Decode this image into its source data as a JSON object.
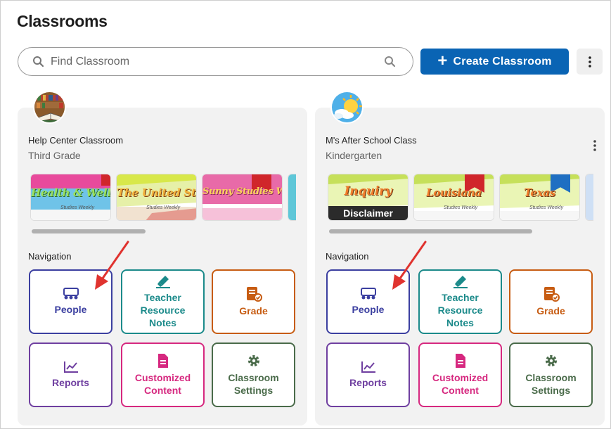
{
  "page": {
    "title": "Classrooms"
  },
  "search": {
    "placeholder": "Find Classroom"
  },
  "toolbar": {
    "create_label": "Create Classroom"
  },
  "classrooms": [
    {
      "name": "Help Center Classroom",
      "grade": "Third Grade",
      "avatar": "books-avatar",
      "books": [
        {
          "title": "Health & Wellness",
          "subtitle": "Studies Weekly"
        },
        {
          "title": "The United States",
          "subtitle": "Studies Weekly"
        },
        {
          "title": "Sunny Studies Weekly",
          "subtitle": ""
        }
      ],
      "navigation_label": "Navigation",
      "tiles": {
        "people": "People",
        "teacher": [
          "Teacher",
          "Resource",
          "Notes"
        ],
        "grade": "Grade",
        "reports": "Reports",
        "custom": [
          "Customized",
          "Content"
        ],
        "settings": [
          "Classroom",
          "Settings"
        ]
      }
    },
    {
      "name": "M's After School Class",
      "grade": "Kindergarten",
      "avatar": "sun-avatar",
      "books": [
        {
          "title": "Inquiry",
          "subtitle": "Studies Weekly",
          "badge": "Disclaimer"
        },
        {
          "title": "Louisiana",
          "subtitle": "Studies Weekly"
        },
        {
          "title": "Texas",
          "subtitle": "Studies Weekly"
        }
      ],
      "navigation_label": "Navigation",
      "tiles": {
        "people": "People",
        "teacher": [
          "Teacher",
          "Resource",
          "Notes"
        ],
        "grade": "Grade",
        "reports": "Reports",
        "custom": [
          "Customized",
          "Content"
        ],
        "settings": [
          "Classroom",
          "Settings"
        ]
      }
    }
  ],
  "colors": {
    "primary": "#0a64b4",
    "people": "#3b3fa0",
    "teacher": "#1b8a8a",
    "grade": "#c75c12",
    "reports": "#6f3fa0",
    "custom": "#d6287f",
    "settings": "#4a6b4a",
    "annotation_arrow": "#e0332f"
  }
}
